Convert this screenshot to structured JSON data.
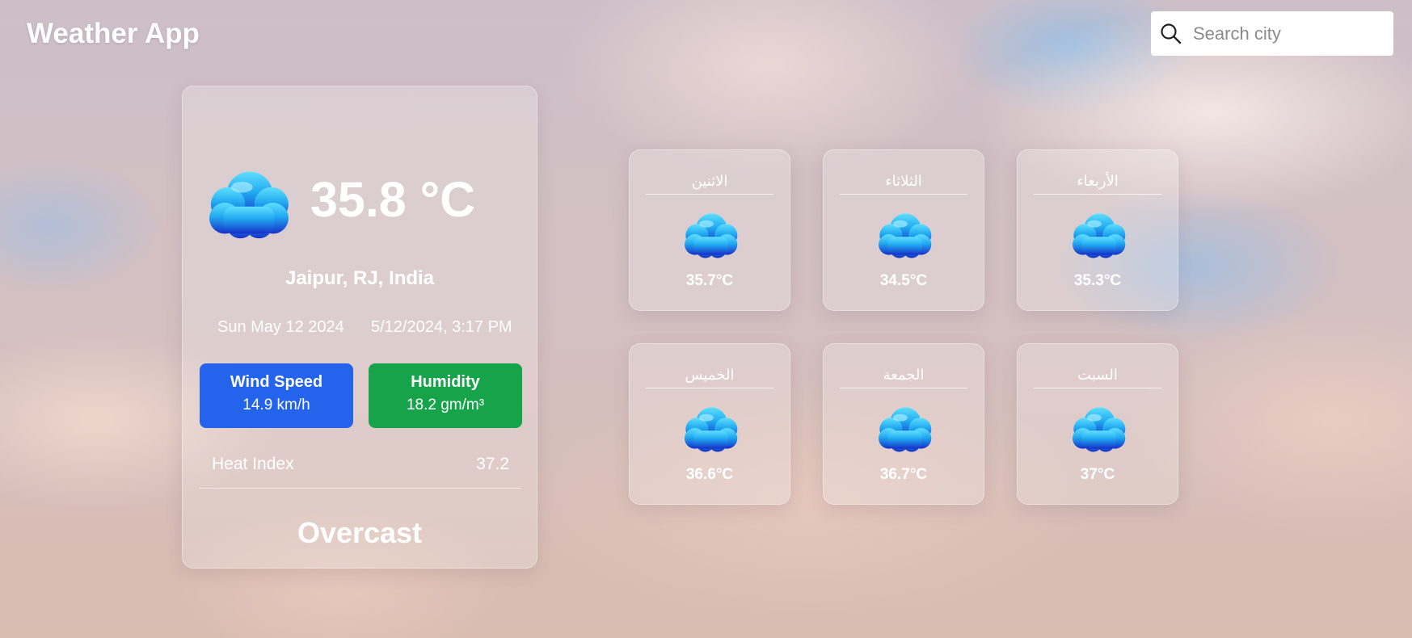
{
  "app": {
    "title": "Weather App"
  },
  "search": {
    "placeholder": "Search city",
    "value": ""
  },
  "current": {
    "temperature": "35.8 °C",
    "location": "Jaipur, RJ, India",
    "date": "Sun May 12 2024",
    "datetime": "5/12/2024, 3:17 PM",
    "wind": {
      "label": "Wind Speed",
      "value": "14.9 km/h",
      "color": "#2463eb"
    },
    "humidity": {
      "label": "Humidity",
      "value": "18.2 gm/m³",
      "color": "#16a34a"
    },
    "heat_index": {
      "label": "Heat Index",
      "value": "37.2"
    },
    "condition": "Overcast",
    "icon": "cloud-icon"
  },
  "forecast": [
    {
      "day": "الاثنين",
      "temp": "35.7°C",
      "icon": "cloud-icon"
    },
    {
      "day": "الثلاثاء",
      "temp": "34.5°C",
      "icon": "cloud-icon"
    },
    {
      "day": "الأربعاء",
      "temp": "35.3°C",
      "icon": "cloud-icon"
    },
    {
      "day": "الخميس",
      "temp": "36.6°C",
      "icon": "cloud-icon"
    },
    {
      "day": "الجمعة",
      "temp": "36.7°C",
      "icon": "cloud-icon"
    },
    {
      "day": "السبت",
      "temp": "37°C",
      "icon": "cloud-icon"
    }
  ]
}
